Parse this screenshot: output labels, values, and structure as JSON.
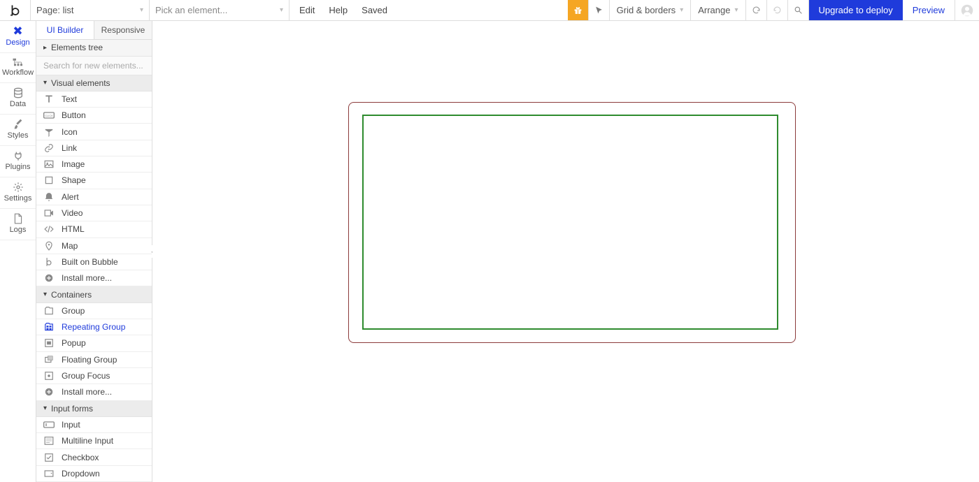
{
  "topbar": {
    "page_prefix": "Page:",
    "page_name": "list",
    "picker_placeholder": "Pick an element...",
    "edit": "Edit",
    "help": "Help",
    "saved": "Saved",
    "grid_borders": "Grid & borders",
    "arrange": "Arrange",
    "upgrade": "Upgrade to deploy",
    "preview": "Preview"
  },
  "rail": {
    "design": "Design",
    "workflow": "Workflow",
    "data": "Data",
    "styles": "Styles",
    "plugins": "Plugins",
    "settings": "Settings",
    "logs": "Logs"
  },
  "panel": {
    "tab_ui": "UI Builder",
    "tab_responsive": "Responsive",
    "elements_tree": "Elements tree",
    "search_placeholder": "Search for new elements...",
    "section_visual": "Visual elements",
    "section_containers": "Containers",
    "section_inputs": "Input forms",
    "items_visual": [
      "Text",
      "Button",
      "Icon",
      "Link",
      "Image",
      "Shape",
      "Alert",
      "Video",
      "HTML",
      "Map",
      "Built on Bubble",
      "Install more..."
    ],
    "items_containers": [
      "Group",
      "Repeating Group",
      "Popup",
      "Floating Group",
      "Group Focus",
      "Install more..."
    ],
    "items_inputs": [
      "Input",
      "Multiline Input",
      "Checkbox",
      "Dropdown"
    ],
    "selected_item": "Repeating Group"
  }
}
